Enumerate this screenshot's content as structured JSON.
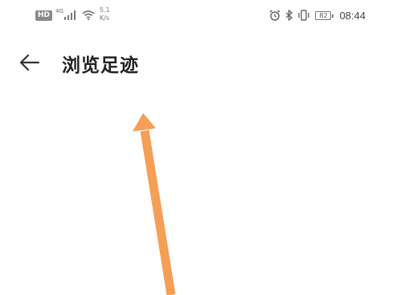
{
  "status_bar": {
    "hd_label": "HD",
    "network_type": "4G",
    "speed_value": "5.1",
    "speed_unit": "K/s",
    "battery": "82",
    "time": "08:44",
    "icons": [
      "signal-icon",
      "wifi-icon",
      "alarm-icon",
      "bluetooth-icon",
      "vibrate-icon",
      "battery-icon"
    ]
  },
  "app_bar": {
    "title": "浏览足迹",
    "back_icon": "arrow-left-icon"
  },
  "annotation": {
    "type": "arrow",
    "color": "#f59a4e"
  }
}
